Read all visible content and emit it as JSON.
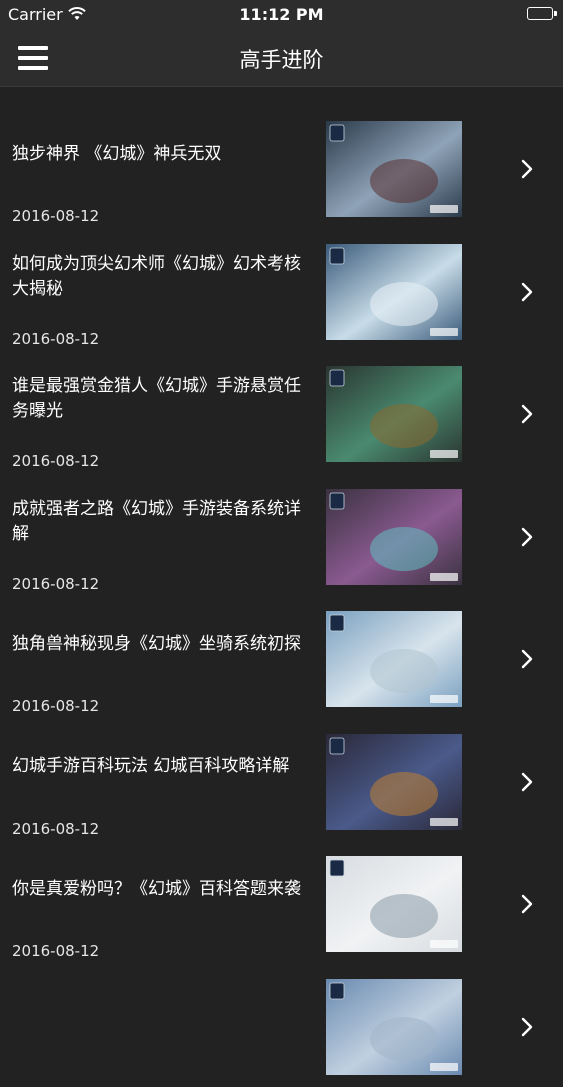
{
  "status_bar": {
    "carrier": "Carrier",
    "time": "11:12 PM"
  },
  "nav": {
    "title": "高手进阶",
    "menu_icon": "hamburger-menu-icon"
  },
  "articles": [
    {
      "title": "独步神界 《幻城》神兵无双",
      "date": "2016-08-12",
      "thumb_colors": [
        "#2a3a4a",
        "#8fa3b8",
        "#5a3030"
      ]
    },
    {
      "title": "如何成为顶尖幻术师《幻城》幻术考核大揭秘",
      "date": "2016-08-12",
      "thumb_colors": [
        "#3a5a7a",
        "#c8dce8",
        "#e8f0f6"
      ]
    },
    {
      "title": "谁是最强赏金猎人《幻城》手游悬赏任务曝光",
      "date": "2016-08-12",
      "thumb_colors": [
        "#2a3530",
        "#4a8a70",
        "#8a6a30"
      ]
    },
    {
      "title": "成就强者之路《幻城》手游装备系统详解",
      "date": "2016-08-12",
      "thumb_colors": [
        "#3a3240",
        "#8a5a90",
        "#60c0c0"
      ]
    },
    {
      "title": "独角兽神秘现身《幻城》坐骑系统初探",
      "date": "2016-08-12",
      "thumb_colors": [
        "#7aa0c0",
        "#d8e4ec",
        "#b0c4d0"
      ]
    },
    {
      "title": "幻城手游百科玩法 幻城百科攻略详解",
      "date": "2016-08-12",
      "thumb_colors": [
        "#2a2838",
        "#4a5a8a",
        "#c08030"
      ]
    },
    {
      "title": "你是真爱粉吗？《幻城》百科答题来袭",
      "date": "2016-08-12",
      "thumb_colors": [
        "#d8dce0",
        "#f0f2f4",
        "#8a9aa8"
      ]
    },
    {
      "title": "",
      "date": "",
      "thumb_colors": [
        "#6a8ab0",
        "#c0d0e0",
        "#a0b4c8"
      ]
    }
  ]
}
